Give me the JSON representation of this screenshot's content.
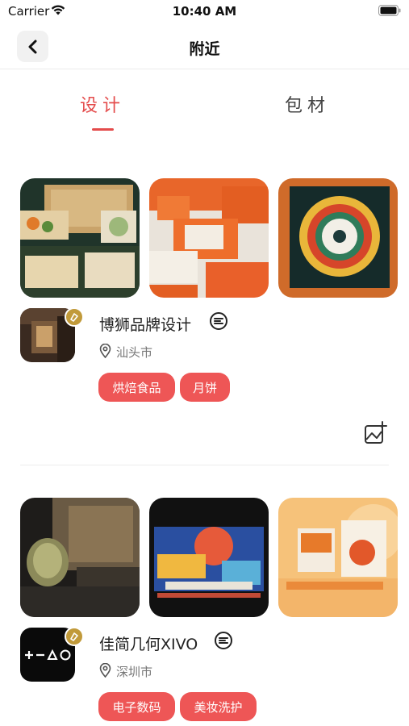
{
  "status_bar": {
    "carrier": "Carrier",
    "time": "10:40 AM"
  },
  "nav": {
    "title": "附近",
    "back_icon": "chevron-left-icon"
  },
  "tabs": [
    {
      "label": "设计",
      "active": true
    },
    {
      "label": "包材",
      "active": false
    }
  ],
  "accent_color": "#e44b4b",
  "tag_color": "#ee5656",
  "studios": [
    {
      "name": "博狮品牌设计",
      "city": "汕头市",
      "tags": [
        "烘焙食品",
        "月饼"
      ],
      "verified_badge": true
    },
    {
      "name": "佳简几何XIVO",
      "city": "深圳市",
      "tags": [
        "电子数码",
        "美妆洗护"
      ],
      "verified_badge": true
    }
  ]
}
